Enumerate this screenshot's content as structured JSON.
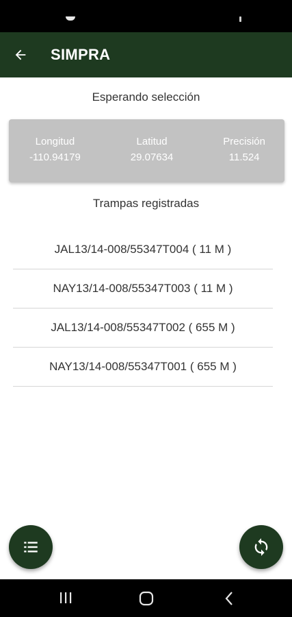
{
  "app_bar": {
    "title": "SIMPRA",
    "back_icon": "arrow-left-icon"
  },
  "selection": {
    "status": "Esperando selección"
  },
  "coordinates": {
    "longitude_label": "Longitud",
    "longitude_value": "-110.94179",
    "latitude_label": "Latitud",
    "latitude_value": "29.07634",
    "precision_label": "Precisión",
    "precision_value": "11.524"
  },
  "traps": {
    "title": "Trampas registradas",
    "items": [
      {
        "label": "JAL13/14-008/55347T004 ( 11 M )"
      },
      {
        "label": "NAY13/14-008/55347T003 ( 11 M )"
      },
      {
        "label": "JAL13/14-008/55347T002 ( 655 M )"
      },
      {
        "label": "NAY13/14-008/55347T001 ( 655 M )"
      }
    ]
  },
  "fabs": {
    "left_icon": "list-icon",
    "right_icon": "sync-icon"
  },
  "nav": {
    "recents_icon": "recents-icon",
    "home_icon": "home-icon",
    "back_icon": "back-chevron-icon"
  },
  "colors": {
    "primary": "#1e3a20",
    "card": "#c2c2c2",
    "text": "#333333"
  }
}
